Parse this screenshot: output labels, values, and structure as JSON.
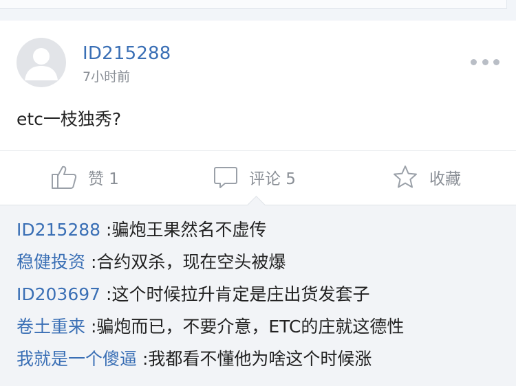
{
  "post": {
    "username": "ID215288",
    "timestamp": "7小时前",
    "content": "etc一枝独秀?"
  },
  "actions": {
    "like_label": "赞 1",
    "comment_label": "评论 5",
    "favorite_label": "收藏"
  },
  "comments": [
    {
      "author": "ID215288 ",
      "text": ":骗炮王果然名不虚传"
    },
    {
      "author": "稳健投资 ",
      "text": ":合约双杀，现在空头被爆"
    },
    {
      "author": "ID203697 ",
      "text": ":这个时候拉升肯定是庄出货发套子"
    },
    {
      "author": "卷土重来 ",
      "text": ":骗炮而已，不要介意，ETC的庄就这德性"
    },
    {
      "author": "我就是一个傻逼 ",
      "text": ":我都看不懂他为啥这个时候涨"
    }
  ],
  "colors": {
    "link": "#3a6fb5",
    "text": "#222222",
    "muted": "#8a8f96",
    "comment_bg": "#f2f4f7"
  },
  "icons": [
    "more-dots-icon",
    "thumbs-up-icon",
    "comment-bubble-icon",
    "star-icon",
    "avatar-placeholder-icon"
  ]
}
